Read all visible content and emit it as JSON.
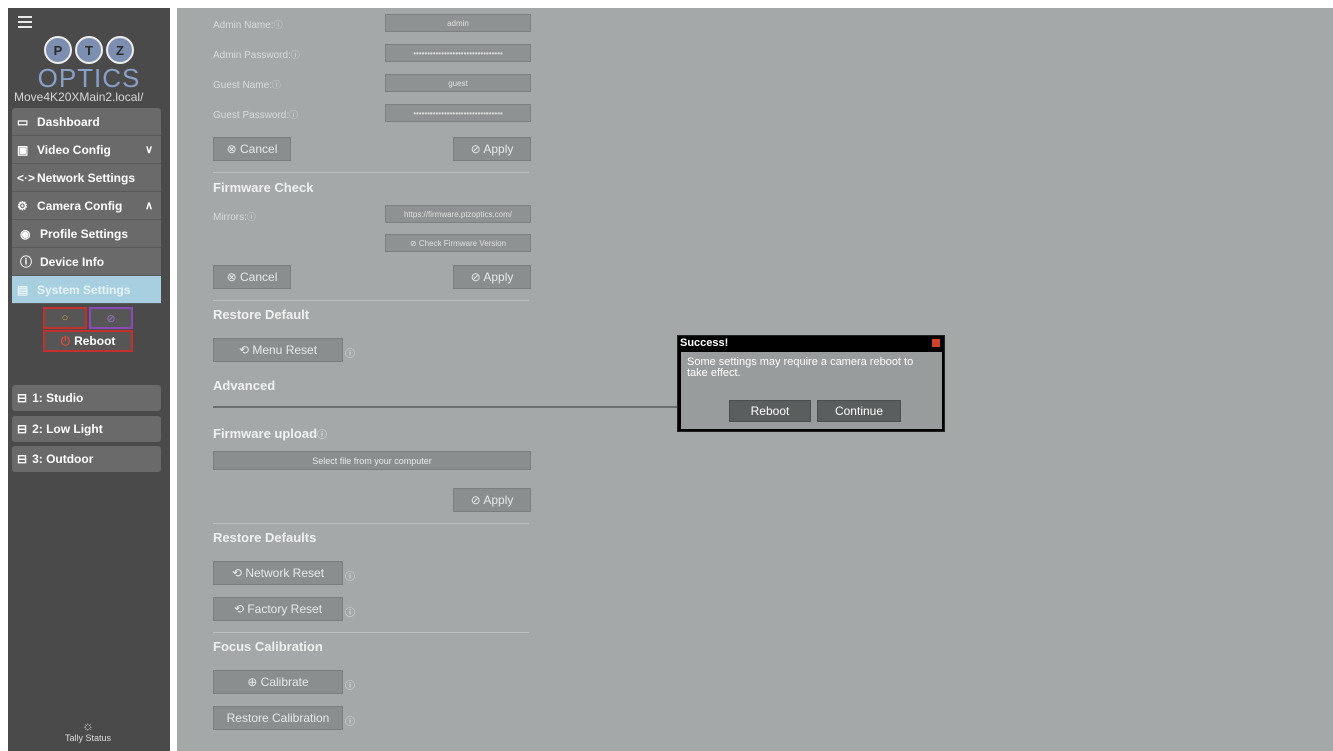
{
  "sidebar": {
    "logo_letters": [
      "P",
      "T",
      "Z"
    ],
    "logo_word": "OPTICS",
    "host": "Move4K20XMain2.local/",
    "nav": [
      {
        "label": "Dashboard",
        "icon": "camera-icon"
      },
      {
        "label": "Video Config",
        "icon": "video-settings-icon"
      },
      {
        "label": "Network Settings",
        "icon": "network-icon"
      },
      {
        "label": "Camera Config",
        "icon": "gear-icon"
      },
      {
        "label": "Profile Settings",
        "icon": "user-icon"
      },
      {
        "label": "Device Info",
        "icon": "info-icon"
      },
      {
        "label": "System Settings",
        "icon": "system-icon"
      }
    ],
    "power_glyphs": [
      "○",
      "⊘"
    ],
    "reboot_label": "Reboot",
    "presets": [
      {
        "label": "1: Studio"
      },
      {
        "label": "2: Low Light"
      },
      {
        "label": "3: Outdoor"
      }
    ],
    "tally_label": "Tally Status"
  },
  "main": {
    "admin_name_label": "Admin Name:",
    "admin_name_value": "admin",
    "admin_password_label": "Admin Password:",
    "admin_password_value": "••••••••••••••••••••••••••••••••",
    "guest_name_label": "Guest Name:",
    "guest_name_value": "guest",
    "guest_password_label": "Guest Password:",
    "guest_password_value": "••••••••••••••••••••••••••••••••",
    "cancel_label": "⊗ Cancel",
    "apply_label": "⊘ Apply",
    "firmware_check_title": "Firmware Check",
    "mirrors_label": "Mirrors:",
    "mirrors_value": "https://firmware.ptzoptics.com/",
    "check_firmware_label": "⊘ Check Firmware Version",
    "restore_default_title": "Restore Default",
    "menu_reset_label": "⟲ Menu Reset",
    "advanced_title": "Advanced",
    "firmware_upload_title": "Firmware upload",
    "select_file_label": "Select file from your computer",
    "restore_defaults_title": "Restore Defaults",
    "network_reset_label": "⟲ Network Reset",
    "factory_reset_label": "⟲ Factory Reset",
    "focus_calibration_title": "Focus Calibration",
    "calibrate_label": "⊕ Calibrate",
    "restore_calibration_label": "Restore Calibration",
    "info_glyph": "ⓘ"
  },
  "dialog": {
    "title": "Success!",
    "message": "Some settings may require a camera reboot to take effect.",
    "reboot_label": "Reboot",
    "continue_label": "Continue"
  }
}
